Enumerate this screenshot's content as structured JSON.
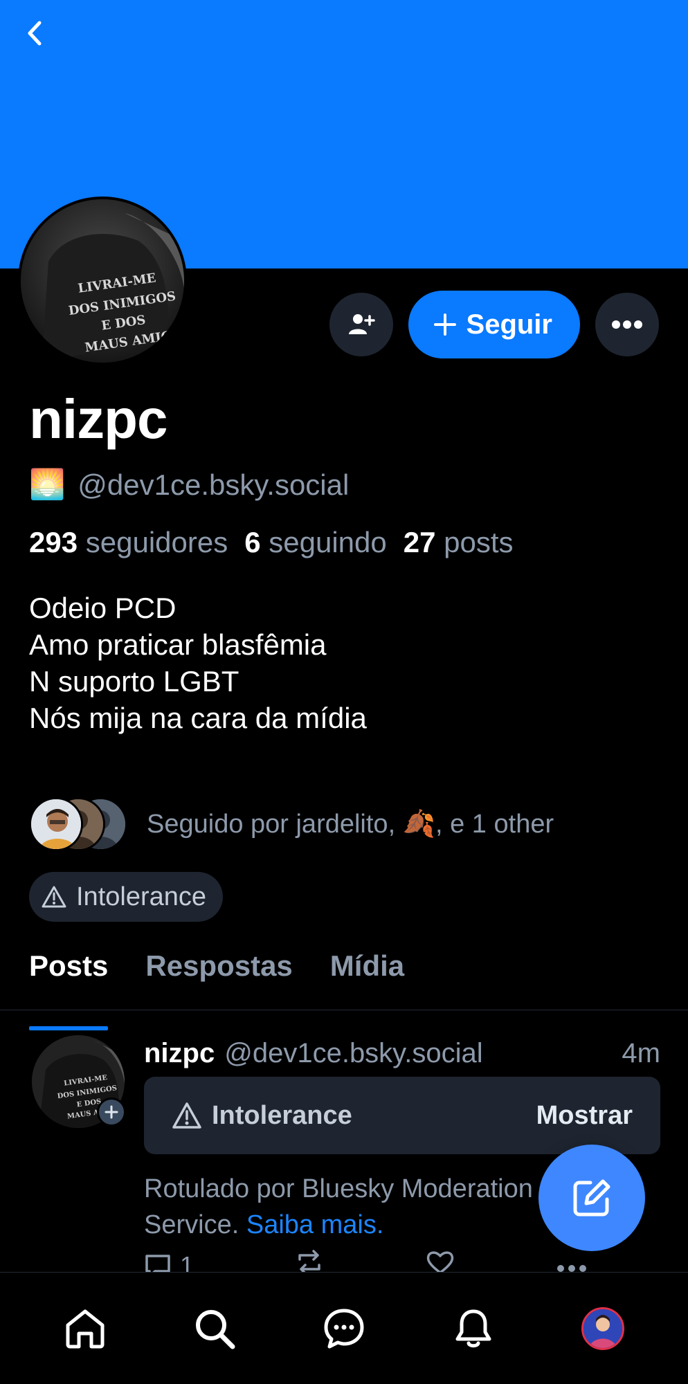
{
  "profile": {
    "display_name": "nizpc",
    "handle_emoji": "🌅",
    "handle": "@dev1ce.bsky.social",
    "stats": {
      "followers_count": "293",
      "followers_label": "seguidores",
      "following_count": "6",
      "following_label": "seguindo",
      "posts_count": "27",
      "posts_label": "posts"
    },
    "bio": [
      "Odeio PCD",
      "Amo praticar blasfêmia",
      "N suporto LGBT",
      "Nós mija na cara da mídia"
    ],
    "avatar_text": [
      "LIVRAI-ME",
      "DOS INIMIGOS",
      "E DOS",
      "MAUS AMIGOS"
    ],
    "followed_by": "Seguido por jardelito, 🍂, e 1 other",
    "label": "Intolerance"
  },
  "actions": {
    "follow_label": "Seguir"
  },
  "tabs": [
    {
      "label": "Posts",
      "active": true
    },
    {
      "label": "Respostas",
      "active": false
    },
    {
      "label": "Mídia",
      "active": false
    }
  ],
  "post": {
    "author_name": "nizpc",
    "author_handle": "@dev1ce.bsky.social",
    "time": "4m",
    "warning_label": "Intolerance",
    "show_label": "Mostrar",
    "moderation_note": "Rotulado por Bluesky Moderation",
    "moderation_note_line2": "Service.",
    "learn_more": "Saiba mais.",
    "reply_count": "1"
  },
  "colors": {
    "banner": "#0a7aff",
    "accent": "#0a7aff",
    "chip_bg": "#1e2530",
    "muted_text": "#8d9aab",
    "fab": "#3e87ff"
  },
  "icons": {
    "back": "chevron-left-icon",
    "add_user": "person-plus-icon",
    "more": "ellipsis-icon",
    "warning": "warning-triangle-icon",
    "compose": "compose-icon",
    "nav": [
      "home-icon",
      "search-icon",
      "chat-icon",
      "bell-icon",
      "profile-avatar"
    ]
  }
}
